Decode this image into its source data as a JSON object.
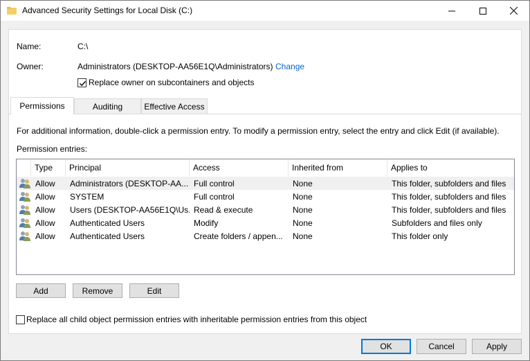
{
  "window": {
    "title": "Advanced Security Settings for Local Disk (C:)"
  },
  "info": {
    "name_label": "Name:",
    "name_value": "C:\\",
    "owner_label": "Owner:",
    "owner_value": "Administrators (DESKTOP-AA56E1Q\\Administrators)",
    "change_link": "Change",
    "replace_owner_label": "Replace owner on subcontainers and objects",
    "replace_owner_checked": true
  },
  "tabs": [
    {
      "label": "Permissions",
      "active": true
    },
    {
      "label": "Auditing",
      "active": false
    },
    {
      "label": "Effective Access",
      "active": false
    }
  ],
  "permissions": {
    "info_text": "For additional information, double-click a permission entry. To modify a permission entry, select the entry and click Edit (if available).",
    "entries_label": "Permission entries:",
    "columns": [
      "Type",
      "Principal",
      "Access",
      "Inherited from",
      "Applies to"
    ],
    "rows": [
      [
        "Allow",
        "Administrators (DESKTOP-AA...",
        "Full control",
        "None",
        "This folder, subfolders and files"
      ],
      [
        "Allow",
        "SYSTEM",
        "Full control",
        "None",
        "This folder, subfolders and files"
      ],
      [
        "Allow",
        "Users (DESKTOP-AA56E1Q\\Us...",
        "Read & execute",
        "None",
        "This folder, subfolders and files"
      ],
      [
        "Allow",
        "Authenticated Users",
        "Modify",
        "None",
        "Subfolders and files only"
      ],
      [
        "Allow",
        "Authenticated Users",
        "Create folders / appen...",
        "None",
        "This folder only"
      ]
    ],
    "add_label": "Add",
    "remove_label": "Remove",
    "edit_label": "Edit",
    "replace_child_label": "Replace all child object permission entries with inheritable permission entries from this object",
    "replace_child_checked": false
  },
  "footer": {
    "ok_label": "OK",
    "cancel_label": "Cancel",
    "apply_label": "Apply"
  },
  "colors": {
    "link": "#0066cc",
    "focus_border": "#0078d7",
    "folder_icon": "#e8b84a"
  }
}
